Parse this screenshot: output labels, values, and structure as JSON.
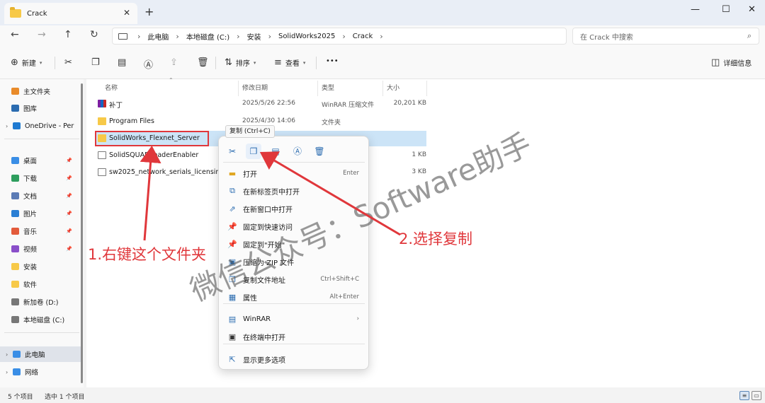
{
  "tab": {
    "title": "Crack",
    "close": "✕",
    "new": "+"
  },
  "window": {
    "minimize": "—",
    "maximize": "☐",
    "close": "✕"
  },
  "nav": {
    "back": "←",
    "forward": "→",
    "up": "↑",
    "refresh": "↻"
  },
  "address": {
    "crumbs": [
      "此电脑",
      "本地磁盘 (C:)",
      "安装",
      "SolidWorks2025",
      "Crack"
    ],
    "sep": "›",
    "search_placeholder": "在 Crack 中搜索"
  },
  "toolbar": {
    "new": "新建",
    "sort": "排序",
    "view": "查看",
    "more": "•••",
    "details": "详细信息"
  },
  "sidebar": {
    "items": [
      {
        "label": "主文件夹",
        "icon": "home-icon",
        "color": "#e98b2a"
      },
      {
        "label": "图库",
        "icon": "gallery-icon",
        "color": "#2b6cb0"
      },
      {
        "label": "OneDrive - Per",
        "icon": "cloud-icon",
        "color": "#1f7ad1"
      },
      {
        "label": "桌面",
        "icon": "desktop-icon",
        "color": "#3a8ee6"
      },
      {
        "label": "下载",
        "icon": "download-icon",
        "color": "#2e9e5e"
      },
      {
        "label": "文档",
        "icon": "document-icon",
        "color": "#5b7bb5"
      },
      {
        "label": "图片",
        "icon": "picture-icon",
        "color": "#2a7fd4"
      },
      {
        "label": "音乐",
        "icon": "music-icon",
        "color": "#e35b3b"
      },
      {
        "label": "视频",
        "icon": "video-icon",
        "color": "#8a4fc9"
      },
      {
        "label": "安装",
        "icon": "folder-icon",
        "color": "#f7c948"
      },
      {
        "label": "软件",
        "icon": "folder-icon",
        "color": "#f7c948"
      },
      {
        "label": "新加卷 (D:)",
        "icon": "drive-icon",
        "color": "#777777"
      },
      {
        "label": "本地磁盘 (C:)",
        "icon": "drive-icon",
        "color": "#777777"
      },
      {
        "label": "此电脑",
        "icon": "pc-icon",
        "color": "#3a8ee6"
      },
      {
        "label": "网络",
        "icon": "network-icon",
        "color": "#3a8ee6"
      }
    ]
  },
  "columns": {
    "name": "名称",
    "date": "修改日期",
    "type": "类型",
    "size": "大小"
  },
  "files": [
    {
      "name": "补丁",
      "date": "2025/5/26 22:56",
      "type": "WinRAR 压缩文件",
      "size": "20,201 KB",
      "icon": "rar"
    },
    {
      "name": "Program Files",
      "date": "2025/4/30 14:06",
      "type": "文件夹",
      "size": "",
      "icon": "folder"
    },
    {
      "name": "SolidWorks_Flexnet_Server",
      "date": "",
      "type": "",
      "size": "",
      "icon": "folder"
    },
    {
      "name": "SolidSQUADLoaderEnabler",
      "date": "",
      "type": "",
      "size": "1 KB",
      "icon": "doc"
    },
    {
      "name": "sw2025_network_serials_licensing",
      "date": "",
      "type": "",
      "size": "3 KB",
      "icon": "doc"
    }
  ],
  "tooltip": "复制 (Ctrl+C)",
  "context_menu": {
    "items": [
      {
        "label": "打开",
        "shortcut": "Enter",
        "icon": "folder-open-icon"
      },
      {
        "label": "在新标签页中打开",
        "shortcut": "",
        "icon": "new-tab-icon"
      },
      {
        "label": "在新窗口中打开",
        "shortcut": "",
        "icon": "new-window-icon"
      },
      {
        "label": "固定到快速访问",
        "shortcut": "",
        "icon": "pin-icon"
      },
      {
        "label": "固定到\"开始\"",
        "shortcut": "",
        "icon": "pin-start-icon"
      },
      {
        "label": "压缩为 ZIP 文件",
        "shortcut": "",
        "icon": "zip-icon"
      },
      {
        "label": "复制文件地址",
        "shortcut": "Ctrl+Shift+C",
        "icon": "copy-path-icon"
      },
      {
        "label": "属性",
        "shortcut": "Alt+Enter",
        "icon": "properties-icon"
      },
      {
        "label": "WinRAR",
        "shortcut": "›",
        "icon": "winrar-icon"
      },
      {
        "label": "在终端中打开",
        "shortcut": "",
        "icon": "terminal-icon"
      },
      {
        "label": "显示更多选项",
        "shortcut": "",
        "icon": "more-options-icon"
      }
    ]
  },
  "status": {
    "count": "5 个项目",
    "selected": "选中 1 个项目"
  },
  "annotations": {
    "step1": "1.右键这个文件夹",
    "step2": "2.选择复制",
    "watermark": "微信公众号：Software助手",
    "color": "#e0373b"
  }
}
